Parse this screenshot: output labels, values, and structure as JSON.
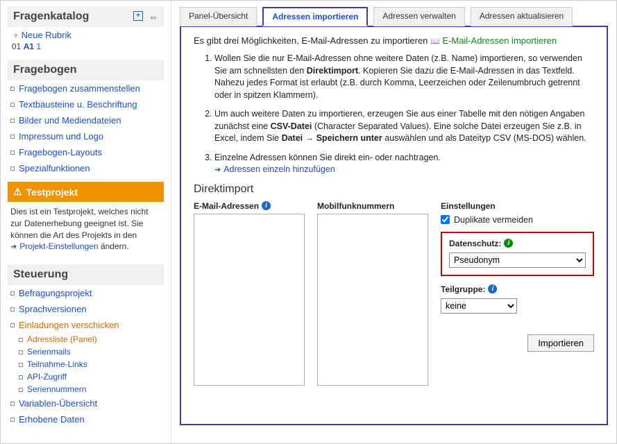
{
  "sidebar": {
    "s1": {
      "title": "Fragenkatalog",
      "newRubric": "Neue Rubrik",
      "num": "01",
      "bold": "A1",
      "tail": "1"
    },
    "s2": {
      "title": "Fragebogen",
      "items": [
        "Fragebogen zusammenstellen",
        "Textbausteine u. Beschriftung",
        "Bilder und Mediendateien",
        "Impressum und Logo",
        "Fragebogen-Layouts",
        "Spezialfunktionen"
      ]
    },
    "warnTitle": "Testprojekt",
    "warnBody": "Dies ist ein Testprojekt, welches nicht zur Datenerhebung geeignet ist. Sie können die Art des Projekts in den ",
    "warnLink": "Projekt-Einstellungen",
    "warnTail": " ändern.",
    "s3": {
      "title": "Steuerung",
      "items": [
        "Befragungsprojekt",
        "Sprachversionen",
        "Einladungen verschicken",
        "Variablen-Übersicht",
        "Erhobene Daten"
      ],
      "sub": [
        "Adressliste (Panel)",
        "Serienmails",
        "Teilnahme-Links",
        "API-Zugriff",
        "Seriennummern"
      ]
    }
  },
  "tabs": [
    "Panel-Übersicht",
    "Adressen importieren",
    "Adressen verwalten",
    "Adressen aktualisieren"
  ],
  "activeTab": 1,
  "content": {
    "intro": "Es gibt drei Möglichkeiten, E-Mail-Adressen zu importieren ",
    "introLinkIcon": "📖",
    "introLink": "E-Mail-Adressen importieren",
    "ol1a": "Wollen Sie die nur E-Mail-Adressen ohne weitere Daten (z.B. Name) importieren, so verwenden Sie am schnellsten den ",
    "ol1b": "Direktimport",
    "ol1c": ". Kopieren Sie dazu die E-Mail-Adressen in das Textfeld. Nahezu jedes Format ist erlaubt (z.B. durch Komma, Leerzeichen oder Zeilenumbruch getrennt oder in spitzen Klammern).",
    "ol2a": "Um auch weitere Daten zu importieren, erzeugen Sie aus einer Tabelle mit den nötigen Angaben zunächst eine ",
    "ol2b": "CSV-Datei",
    "ol2c": " (Character Separated Values). Eine solche Datei erzeugen Sie z.B. in Excel, indem Sie ",
    "ol2d": "Datei → Speichern unter",
    "ol2e": " auswählen und als Dateityp CSV (MS-DOS) wählen.",
    "ol3a": "Einzelne Adressen können Sie direkt ein- oder nachtragen.",
    "ol3link": "Adressen einzeln hinzufügen",
    "h3": "Direktimport",
    "emailLabel": "E-Mail-Adressen",
    "phoneLabel": "Mobilfunknummern",
    "settingsLabel": "Einstellungen",
    "dupLabel": "Duplikate vermeiden",
    "dupChecked": true,
    "ds": {
      "label": "Datenschutz:",
      "value": "Pseudonym"
    },
    "tg": {
      "label": "Teilgruppe:",
      "value": "keine"
    },
    "importBtn": "Importieren"
  }
}
